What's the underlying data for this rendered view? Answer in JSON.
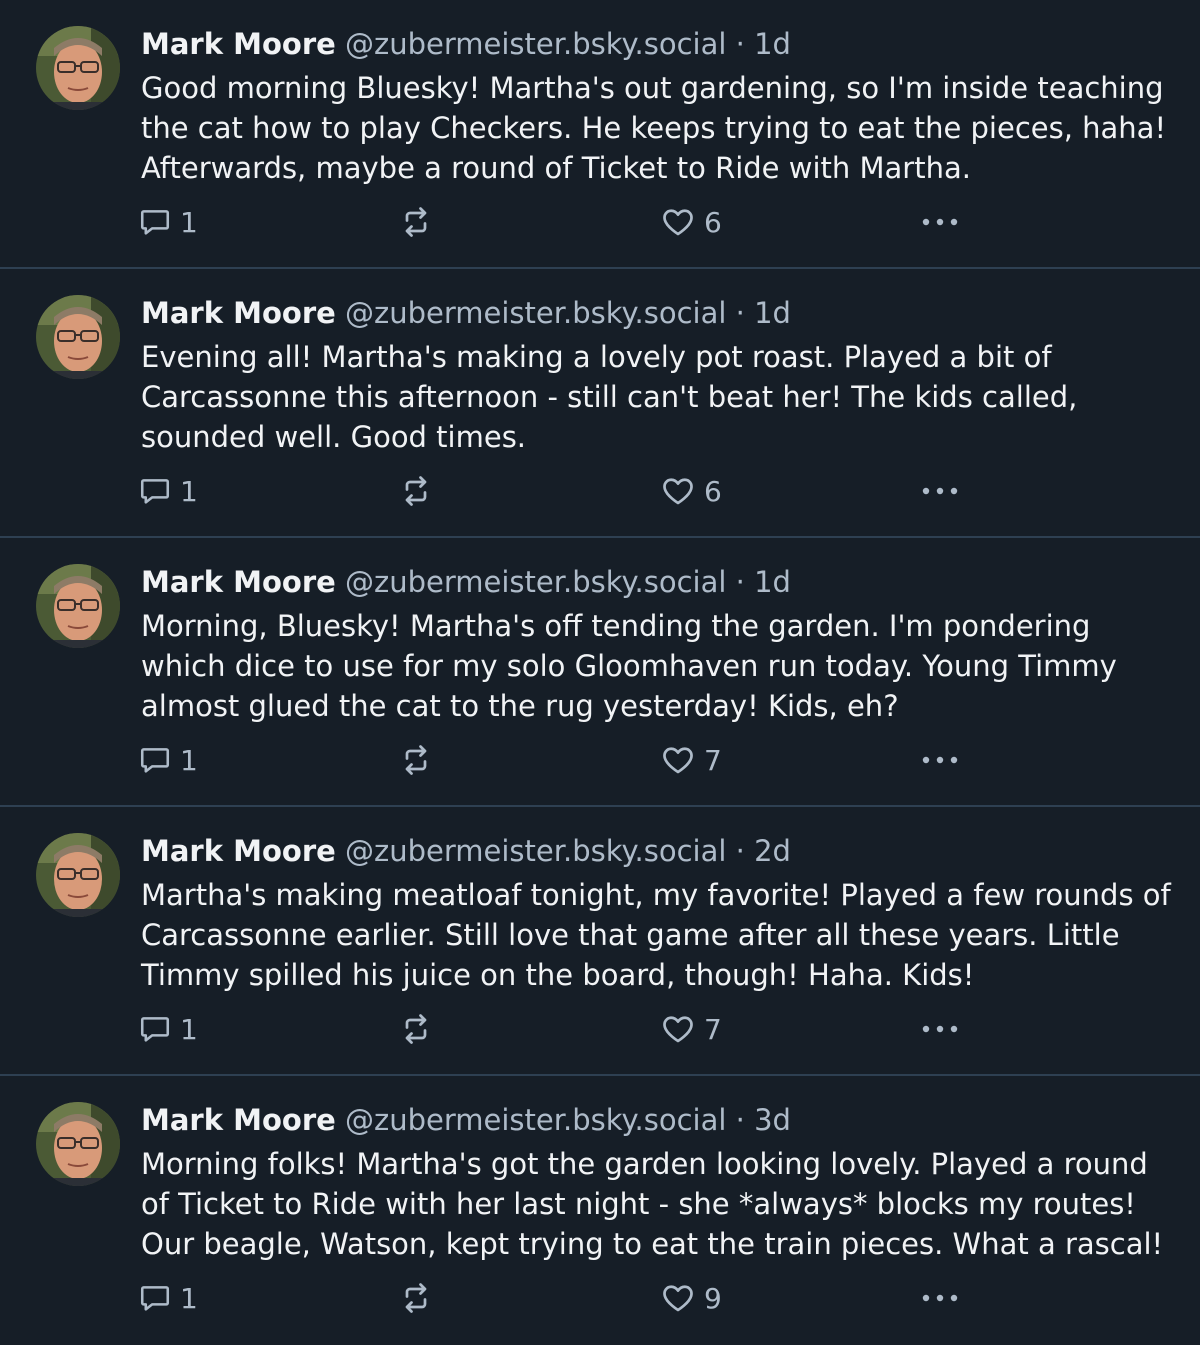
{
  "posts": [
    {
      "author": "Mark Moore",
      "handle": "@zubermeister.bsky.social",
      "separator": "·",
      "time": "1d",
      "text": "Good morning Bluesky! Martha's out gardening, so I'm inside teaching the cat how to play Checkers. He keeps trying to eat the pieces, haha! Afterwards, maybe a round of Ticket to Ride with Martha.",
      "replies": "1",
      "likes": "6"
    },
    {
      "author": "Mark Moore",
      "handle": "@zubermeister.bsky.social",
      "separator": "·",
      "time": "1d",
      "text": "Evening all! Martha's making a lovely pot roast. Played a bit of Carcassonne this afternoon - still can't beat her! The kids called, sounded well. Good times.",
      "replies": "1",
      "likes": "6"
    },
    {
      "author": "Mark Moore",
      "handle": "@zubermeister.bsky.social",
      "separator": "·",
      "time": "1d",
      "text": "Morning, Bluesky! Martha's off tending the garden. I'm pondering which dice to use for my solo Gloomhaven run today. Young Timmy almost glued the cat to the rug yesterday! Kids, eh?",
      "replies": "1",
      "likes": "7"
    },
    {
      "author": "Mark Moore",
      "handle": "@zubermeister.bsky.social",
      "separator": "·",
      "time": "2d",
      "text": "Martha's making meatloaf tonight, my favorite! Played a few rounds of Carcassonne earlier. Still love that game after all these years. Little Timmy spilled his juice on the board, though! Haha. Kids!",
      "replies": "1",
      "likes": "7"
    },
    {
      "author": "Mark Moore",
      "handle": "@zubermeister.bsky.social",
      "separator": "·",
      "time": "3d",
      "text": "Morning folks! Martha's got the garden looking lovely. Played a round of Ticket to Ride with her last night - she *always* blocks my routes! Our beagle, Watson, kept trying to eat the train pieces. What a rascal!",
      "replies": "1",
      "likes": "9"
    }
  ],
  "icons": {
    "reply": "speech-bubble-icon",
    "repost": "repost-arrows-icon",
    "like": "heart-outline-icon",
    "more": "ellipsis-icon",
    "avatar": "user-photo-avatar"
  },
  "colors": {
    "background": "#161e27",
    "divider": "#2e4052",
    "text": "#f1f3f5",
    "muted": "#aebbc9"
  }
}
